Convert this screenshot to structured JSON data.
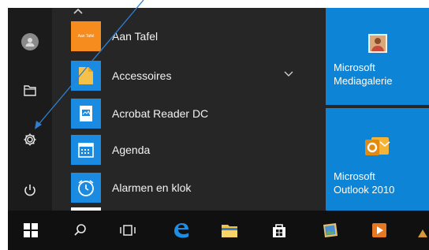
{
  "start_menu": {
    "apps": [
      {
        "label": "Aan Tafel",
        "tile_text": "Aan Tafel",
        "tile_color": "#f78c1e",
        "icon": "aan-tafel-icon"
      },
      {
        "label": "Accessoires",
        "tile_color": "#1a8be0",
        "icon": "folder-icon",
        "expandable": true
      },
      {
        "label": "Acrobat Reader DC",
        "tile_color": "#1a8be0",
        "icon": "acrobat-icon"
      },
      {
        "label": "Agenda",
        "tile_color": "#1a8be0",
        "icon": "calendar-icon"
      },
      {
        "label": "Alarmen en klok",
        "tile_color": "#1a8be0",
        "icon": "alarm-clock-icon"
      }
    ],
    "tiles": [
      {
        "line1": "Microsoft",
        "line2": "Mediagalerie",
        "icon": "media-gallery-icon"
      },
      {
        "line1": "Microsoft",
        "line2": "Outlook 2010",
        "icon": "outlook-icon"
      }
    ],
    "rail_icons": [
      "user-avatar-icon",
      "documents-icon",
      "settings-gear-icon",
      "power-icon"
    ]
  },
  "taskbar": {
    "icons": [
      "windows-start-icon",
      "search-icon",
      "task-view-icon",
      "edge-icon",
      "file-explorer-icon",
      "store-icon",
      "photos-icon",
      "media-player-icon"
    ]
  },
  "colors": {
    "start_bg": "#262626",
    "tile_blue": "#0e84d6",
    "taskbar_bg": "#101010",
    "annotation_line": "#2f7fd1"
  }
}
